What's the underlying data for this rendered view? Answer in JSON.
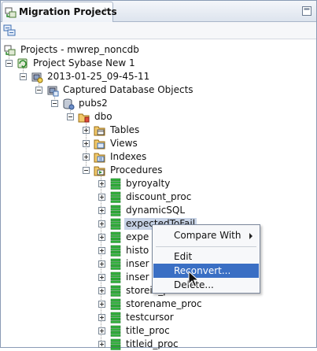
{
  "panel": {
    "title": "Migration Projects",
    "close_glyph": "×"
  },
  "tree": {
    "root": "Projects - mwrep_noncdb",
    "project": "Project Sybase New 1",
    "snapshot": "2013-01-25_09-45-11",
    "captured": "Captured Database Objects",
    "database": "pubs2",
    "schema": "dbo",
    "folders": [
      "Tables",
      "Views",
      "Indexes",
      "Procedures"
    ],
    "procedures": [
      "byroyalty",
      "discount_proc",
      "dynamicSQL",
      "expectedToFail",
      "expe",
      "histo",
      "inser",
      "inser",
      "storeid_proc",
      "storename_proc",
      "testcursor",
      "title_proc",
      "titleid_proc"
    ]
  },
  "context_menu": {
    "items": [
      "Compare With",
      "Edit",
      "Reconvert...",
      "Delete..."
    ]
  },
  "colors": {
    "selection": "#c7d3e6",
    "menu_highlight": "#3a6fc4",
    "procedure_icon": "#2fb53a"
  },
  "icons": {
    "tab": "migration-projects-icon",
    "project": "project-icon",
    "snapshot": "snapshot-icon",
    "database": "database-icon",
    "schema": "schema-icon",
    "folder": "folder-icon",
    "procedure": "procedure-icon"
  }
}
